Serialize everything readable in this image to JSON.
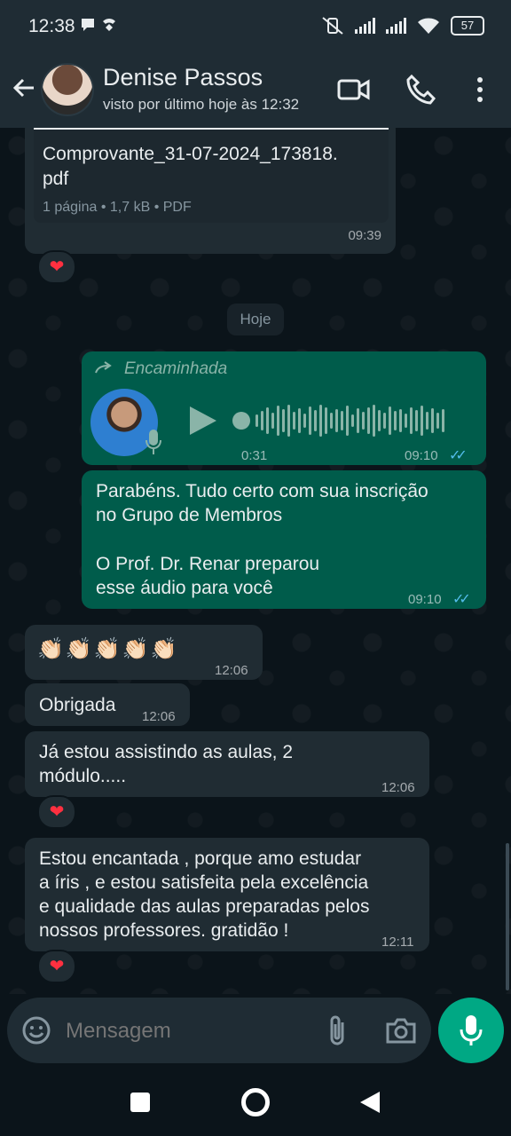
{
  "status_bar": {
    "time": "12:38",
    "battery": "57"
  },
  "header": {
    "contact_name": "Denise Passos",
    "last_seen": "visto por último hoje às 12:32"
  },
  "messages": {
    "doc": {
      "filename_line1": "Comprovante_31-07-2024_173818.",
      "filename_line2": "pdf",
      "meta": "1 página • 1,7 kB • PDF",
      "time": "09:39",
      "reaction": "❤"
    },
    "date_chip": "Hoje",
    "audio": {
      "forwarded_label": "Encaminhada",
      "duration": "0:31",
      "time": "09:10"
    },
    "text_out": {
      "line1": "Parabéns. Tudo certo com sua inscrição",
      "line2": "no Grupo de Membros",
      "line3": "O Prof. Dr. Renar preparou",
      "line4": "esse áudio para você",
      "time": "09:10"
    },
    "clap": {
      "emoji": "👏🏻👏🏻👏🏻👏🏻👏🏻",
      "time": "12:06"
    },
    "thanks": {
      "text": "Obrigada",
      "time": "12:06"
    },
    "watching": {
      "line1": "Já estou assistindo as aulas, 2",
      "line2": "módulo.....",
      "time": "12:06",
      "reaction": "❤"
    },
    "enchanted": {
      "line1": "Estou encantada , porque amo estudar",
      "line2": "a íris , e estou satisfeita  pela excelência",
      "line3": "e qualidade das aulas preparadas pelos",
      "line4": "nossos professores. gratidão !",
      "time": "12:11",
      "reaction": "❤"
    }
  },
  "composer": {
    "placeholder": "Mensagem"
  },
  "colors": {
    "incoming_bubble": "#202c33",
    "outgoing_bubble": "#005c4b",
    "accent": "#00a884",
    "read_ticks": "#53bdeb"
  }
}
